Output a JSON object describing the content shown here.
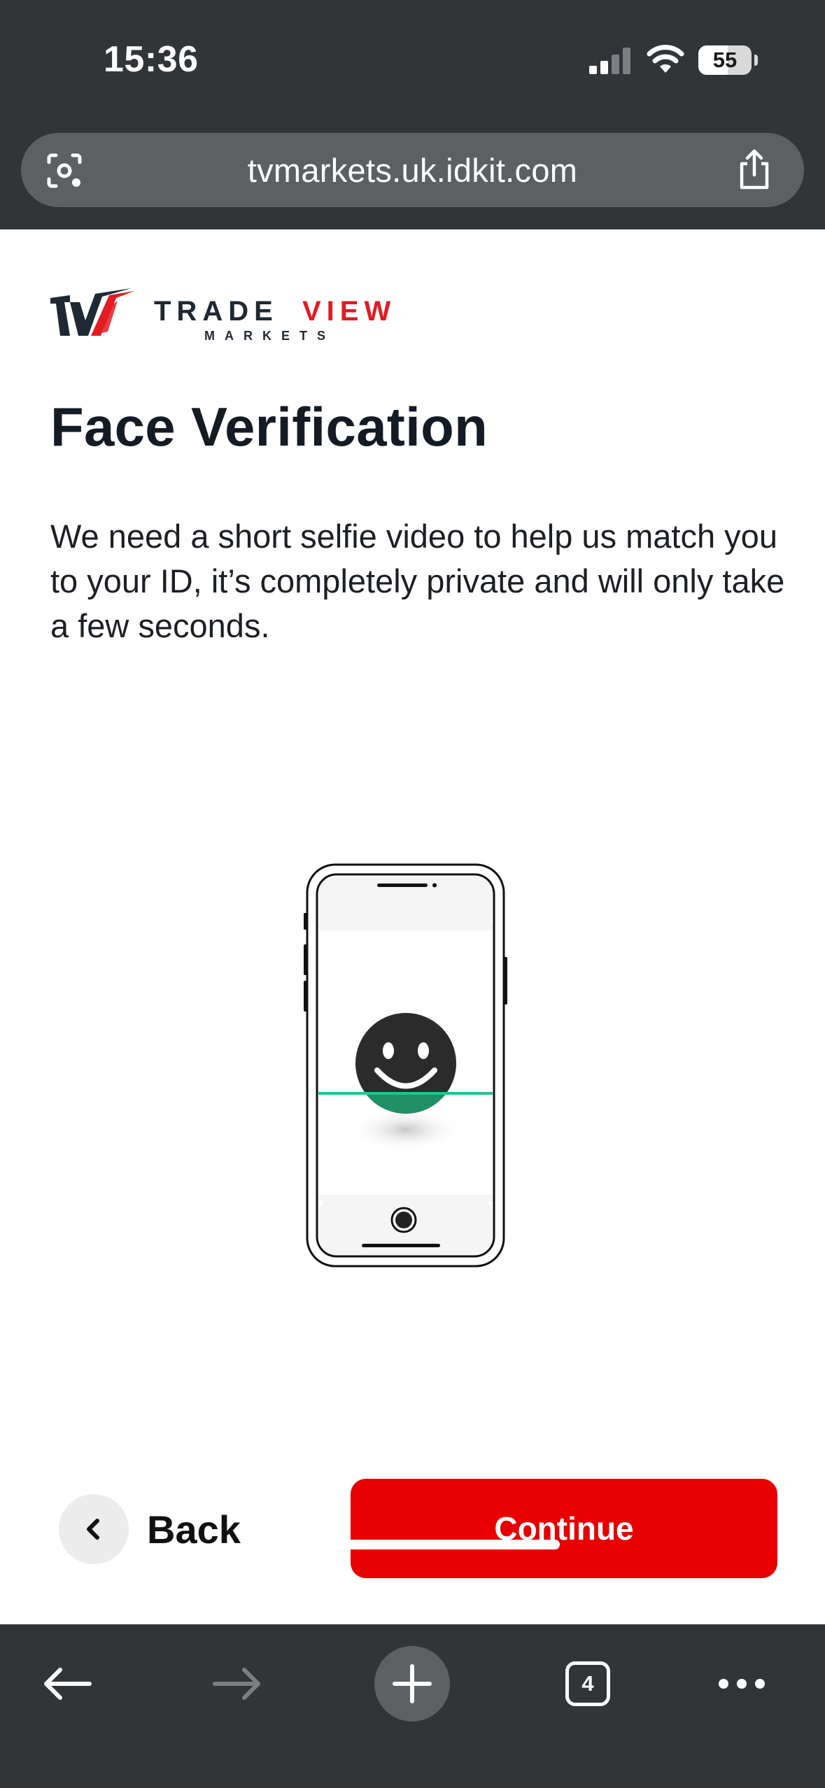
{
  "status_bar": {
    "time": "15:36",
    "battery_level": "55",
    "signal_bars_active": 2,
    "signal_bars_total": 4,
    "icons": [
      "signal-icon",
      "wifi-icon",
      "battery-icon"
    ]
  },
  "browser": {
    "url": "tvmarkets.uk.idkit.com",
    "icons": [
      "lens-icon",
      "share-icon"
    ]
  },
  "logo": {
    "brand_word_dark": "TRADE",
    "brand_word_red": "VIEW",
    "sub_word": "MARKETS"
  },
  "page": {
    "title": "Face Verification",
    "description": "We need a short selfie video to help us match you to your ID, it’s completely private and will only take a few seconds."
  },
  "illustration": {
    "icons": [
      "phone-icon",
      "smiley-face-icon",
      "scan-line-icon"
    ]
  },
  "actions": {
    "back_label": "Back",
    "continue_label": "Continue"
  },
  "toolbar": {
    "open_tabs_count": "4",
    "icons": [
      "back-arrow-icon",
      "forward-arrow-icon",
      "plus-icon",
      "tabs-icon",
      "more-dots-icon"
    ]
  },
  "colors": {
    "chrome_background": "#323538",
    "url_bar": "#5d6063",
    "primary_red": "#e80000",
    "title_text": "#141b24",
    "scan_green": "#22c58b",
    "back_circle": "#ececec"
  }
}
